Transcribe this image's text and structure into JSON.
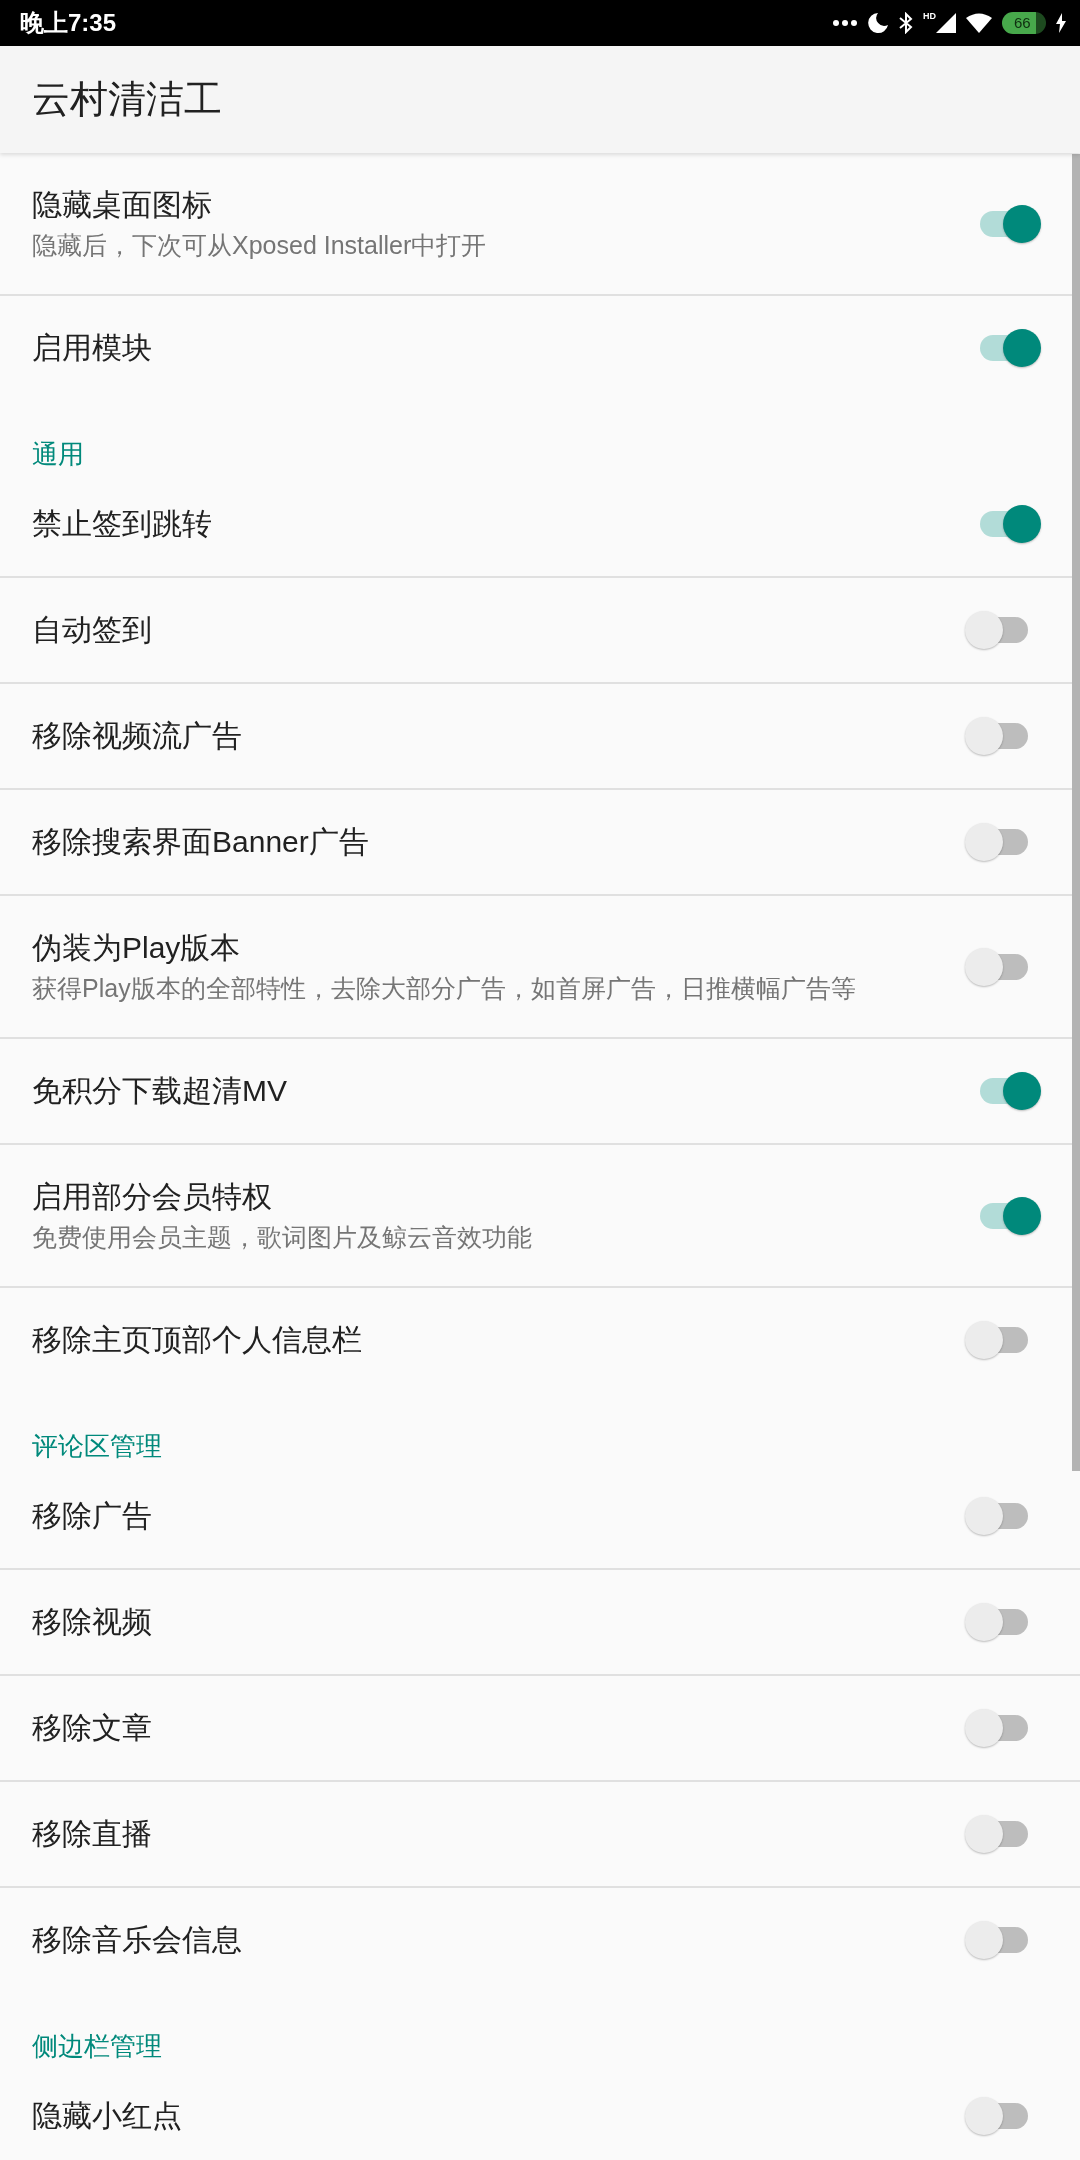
{
  "status_bar": {
    "time": "晚上7:35",
    "network_type": "HD",
    "battery": "66",
    "charging": true
  },
  "app_bar": {
    "title": "云村清洁工"
  },
  "preferences": [
    {
      "kind": "switch",
      "title": "隐藏桌面图标",
      "summary": "隐藏后，下次可从Xposed Installer中打开",
      "on": true
    },
    {
      "kind": "switch",
      "title": "启用模块",
      "on": true
    },
    {
      "kind": "category",
      "title": "通用"
    },
    {
      "kind": "switch",
      "title": "禁止签到跳转",
      "on": true
    },
    {
      "kind": "switch",
      "title": "自动签到",
      "on": false
    },
    {
      "kind": "switch",
      "title": "移除视频流广告",
      "on": false
    },
    {
      "kind": "switch",
      "title": "移除搜索界面Banner广告",
      "on": false
    },
    {
      "kind": "switch",
      "title": "伪装为Play版本",
      "summary": "获得Play版本的全部特性，去除大部分广告，如首屏广告，日推横幅广告等",
      "on": false
    },
    {
      "kind": "switch",
      "title": "免积分下载超清MV",
      "on": true
    },
    {
      "kind": "switch",
      "title": "启用部分会员特权",
      "summary": "免费使用会员主题，歌词图片及鲸云音效功能",
      "on": true
    },
    {
      "kind": "switch",
      "title": "移除主页顶部个人信息栏",
      "on": false
    },
    {
      "kind": "category",
      "title": "评论区管理"
    },
    {
      "kind": "switch",
      "title": "移除广告",
      "on": false
    },
    {
      "kind": "switch",
      "title": "移除视频",
      "on": false
    },
    {
      "kind": "switch",
      "title": "移除文章",
      "on": false
    },
    {
      "kind": "switch",
      "title": "移除直播",
      "on": false
    },
    {
      "kind": "switch",
      "title": "移除音乐会信息",
      "on": false
    },
    {
      "kind": "category",
      "title": "侧边栏管理"
    },
    {
      "kind": "switch",
      "title": "隐藏小红点",
      "on": false
    }
  ]
}
